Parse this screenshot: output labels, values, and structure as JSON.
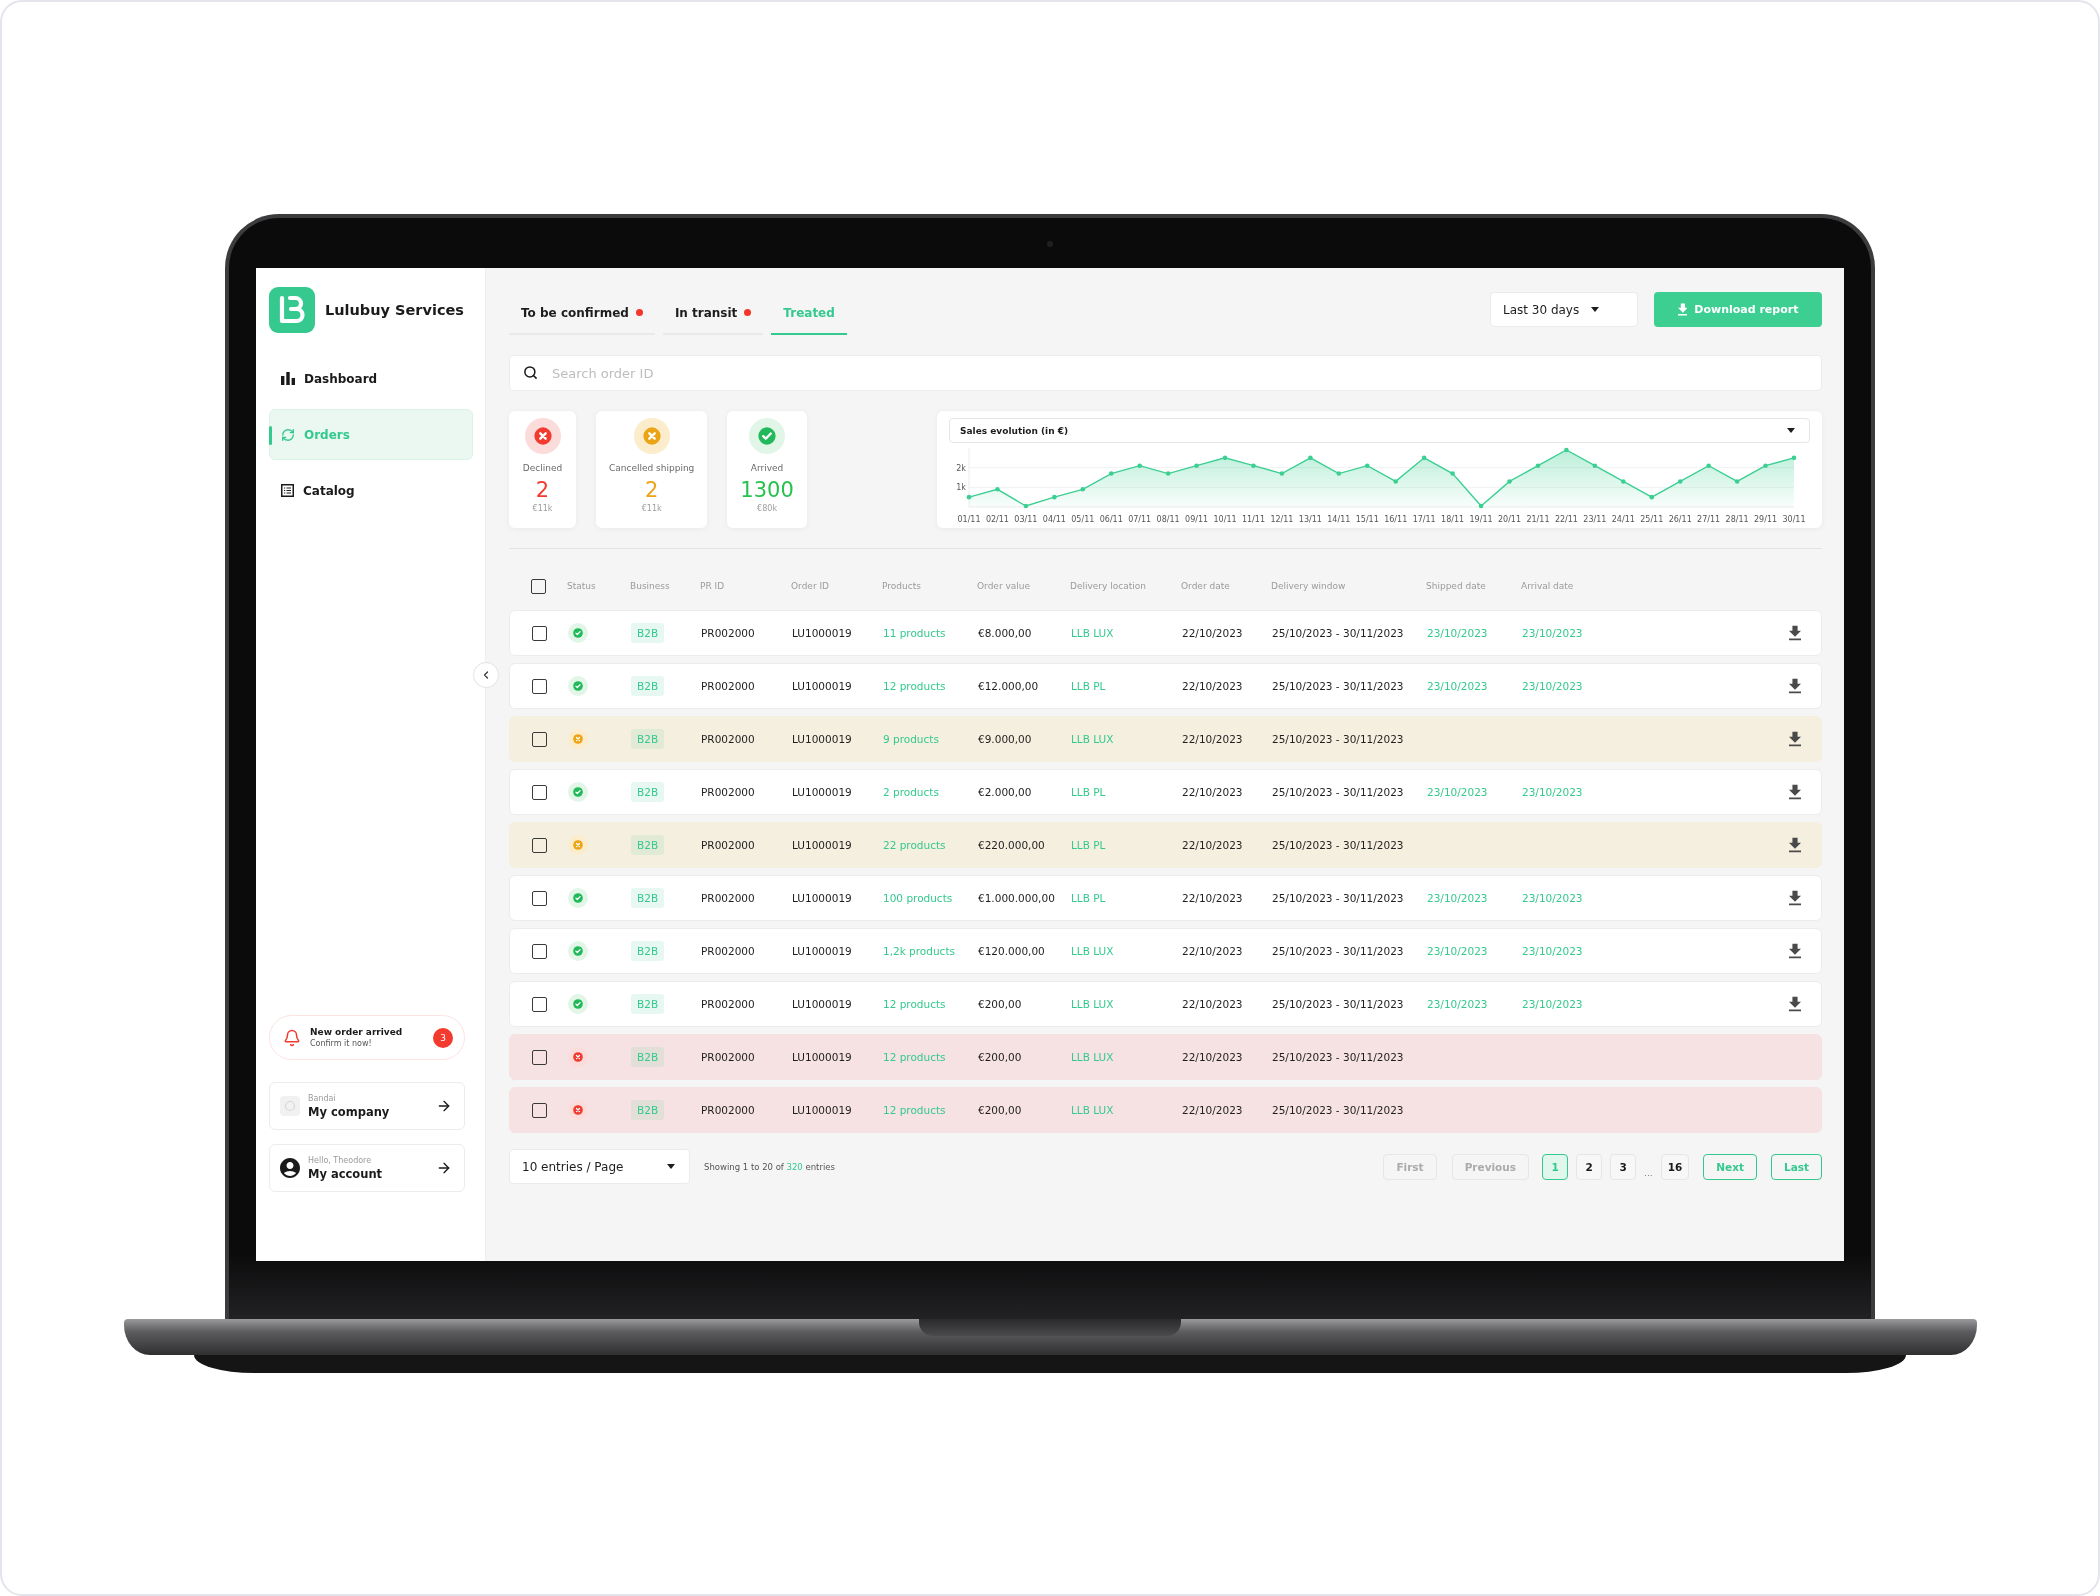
{
  "sidebar": {
    "brand": "Lulubuy Services",
    "nav": [
      {
        "label": "Dashboard",
        "selected": false
      },
      {
        "label": "Orders",
        "selected": true
      },
      {
        "label": "Catalog",
        "selected": false
      }
    ],
    "notification": {
      "title": "New order arrived",
      "subtitle": "Confirm it now!",
      "count": "3"
    },
    "company": {
      "caption": "Bandai",
      "label": "My company"
    },
    "account": {
      "caption": "Hello, Theodore",
      "label": "My account"
    }
  },
  "tabs": [
    {
      "label": "To be confirmed",
      "selected": false,
      "dot": true
    },
    {
      "label": "In transit",
      "selected": false,
      "dot": true
    },
    {
      "label": "Treated",
      "selected": true,
      "dot": false
    }
  ],
  "period": "Last 30 days",
  "download_button": "Download report",
  "search": {
    "placeholder": "Search order ID"
  },
  "summary_cards": [
    {
      "kind": "declined",
      "label": "Declined",
      "value": "2",
      "sub": "€11k"
    },
    {
      "kind": "cancelled",
      "label": "Cancelled shipping",
      "value": "2",
      "sub": "€11k"
    },
    {
      "kind": "arrived",
      "label": "Arrived",
      "value": "1300",
      "sub": "€80k"
    }
  ],
  "chart": {
    "selector": "Sales evolution (in €)",
    "chart_data": {
      "type": "area",
      "categories": [
        "01/11",
        "02/11",
        "03/11",
        "04/11",
        "05/11",
        "06/11",
        "07/11",
        "08/11",
        "09/11",
        "10/11",
        "11/11",
        "12/11",
        "13/11",
        "14/11",
        "15/11",
        "16/11",
        "17/11",
        "18/11",
        "19/11",
        "20/11",
        "21/11",
        "22/11",
        "23/11",
        "24/11",
        "25/11",
        "26/11",
        "27/11",
        "28/11",
        "29/11",
        "30/11"
      ],
      "series": [
        {
          "color": "#3ccf93",
          "values": [
            500,
            900,
            50,
            500,
            900,
            1700,
            2100,
            1700,
            2100,
            2500,
            2100,
            1700,
            2500,
            1700,
            2100,
            1300,
            2500,
            1700,
            50,
            1300,
            2100,
            2900,
            2100,
            1300,
            500,
            1300,
            2100,
            1300,
            2100,
            2500
          ]
        }
      ],
      "ylim": [
        0,
        3000
      ],
      "yticks": [
        {
          "value": 1000,
          "label": "1k"
        },
        {
          "value": 2000,
          "label": "2k"
        }
      ]
    }
  },
  "table": {
    "select_all_checked": false,
    "columns": [
      "Status",
      "Business",
      "PR ID",
      "Order ID",
      "Products",
      "Order value",
      "Delivery location",
      "Order date",
      "Delivery window",
      "Shipped date",
      "Arrival date"
    ],
    "rows": [
      {
        "checked": false,
        "kind": "arrived",
        "business": "B2B",
        "pr_id": "PR002000",
        "order_id": "LU1000019",
        "products": "11 products",
        "order_value": "€8.000,00",
        "delivery_location": "LLB LUX",
        "order_date": "22/10/2023",
        "delivery_window": "25/10/2023 - 30/11/2023",
        "shipped_date": "23/10/2023",
        "arrival_date": "23/10/2023",
        "downloadable": true
      },
      {
        "checked": false,
        "kind": "arrived",
        "business": "B2B",
        "pr_id": "PR002000",
        "order_id": "LU1000019",
        "products": "12 products",
        "order_value": "€12.000,00",
        "delivery_location": "LLB PL",
        "order_date": "22/10/2023",
        "delivery_window": "25/10/2023 - 30/11/2023",
        "shipped_date": "23/10/2023",
        "arrival_date": "23/10/2023",
        "downloadable": true
      },
      {
        "checked": false,
        "kind": "cancelled",
        "business": "B2B",
        "pr_id": "PR002000",
        "order_id": "LU1000019",
        "products": "9 products",
        "order_value": "€9.000,00",
        "delivery_location": "LLB LUX",
        "order_date": "22/10/2023",
        "delivery_window": "25/10/2023 - 30/11/2023",
        "downloadable": true
      },
      {
        "checked": false,
        "kind": "arrived",
        "business": "B2B",
        "pr_id": "PR002000",
        "order_id": "LU1000019",
        "products": "2 products",
        "order_value": "€2.000,00",
        "delivery_location": "LLB PL",
        "order_date": "22/10/2023",
        "delivery_window": "25/10/2023 - 30/11/2023",
        "shipped_date": "23/10/2023",
        "arrival_date": "23/10/2023",
        "downloadable": true
      },
      {
        "checked": false,
        "kind": "cancelled",
        "business": "B2B",
        "pr_id": "PR002000",
        "order_id": "LU1000019",
        "products": "22 products",
        "order_value": "€220.000,00",
        "delivery_location": "LLB PL",
        "order_date": "22/10/2023",
        "delivery_window": "25/10/2023 - 30/11/2023",
        "downloadable": true
      },
      {
        "checked": false,
        "kind": "arrived",
        "business": "B2B",
        "pr_id": "PR002000",
        "order_id": "LU1000019",
        "products": "100 products",
        "order_value": "€1.000.000,00",
        "delivery_location": "LLB PL",
        "order_date": "22/10/2023",
        "delivery_window": "25/10/2023 - 30/11/2023",
        "shipped_date": "23/10/2023",
        "arrival_date": "23/10/2023",
        "downloadable": true
      },
      {
        "checked": false,
        "kind": "arrived",
        "business": "B2B",
        "pr_id": "PR002000",
        "order_id": "LU1000019",
        "products": "1,2k products",
        "order_value": "€120.000,00",
        "delivery_location": "LLB LUX",
        "order_date": "22/10/2023",
        "delivery_window": "25/10/2023 - 30/11/2023",
        "shipped_date": "23/10/2023",
        "arrival_date": "23/10/2023",
        "downloadable": true
      },
      {
        "checked": false,
        "kind": "arrived",
        "business": "B2B",
        "pr_id": "PR002000",
        "order_id": "LU1000019",
        "products": "12 products",
        "order_value": "€200,00",
        "delivery_location": "LLB LUX",
        "order_date": "22/10/2023",
        "delivery_window": "25/10/2023 - 30/11/2023",
        "shipped_date": "23/10/2023",
        "arrival_date": "23/10/2023",
        "downloadable": true
      },
      {
        "checked": false,
        "kind": "declined",
        "business": "B2B",
        "pr_id": "PR002000",
        "order_id": "LU1000019",
        "products": "12 products",
        "order_value": "€200,00",
        "delivery_location": "LLB LUX",
        "order_date": "22/10/2023",
        "delivery_window": "25/10/2023 - 30/11/2023",
        "downloadable": false
      },
      {
        "checked": false,
        "kind": "declined",
        "business": "B2B",
        "pr_id": "PR002000",
        "order_id": "LU1000019",
        "products": "12 products",
        "order_value": "€200,00",
        "delivery_location": "LLB LUX",
        "order_date": "22/10/2023",
        "delivery_window": "25/10/2023 - 30/11/2023",
        "downloadable": false
      }
    ]
  },
  "page_size": "10 entries / Page",
  "showing": {
    "before": "Showing 1 to 20 of",
    "total": "320",
    "after": "entries"
  },
  "pagination": {
    "first": {
      "label": "First",
      "disabled": true
    },
    "previous": {
      "label": "Previous",
      "disabled": true
    },
    "pages": [
      {
        "kind": "page",
        "label": "1",
        "selected": true
      },
      {
        "kind": "page",
        "label": "2",
        "selected": false
      },
      {
        "kind": "page",
        "label": "3",
        "selected": false
      },
      {
        "kind": "gap",
        "label": "..."
      },
      {
        "kind": "page",
        "label": "16",
        "selected": false
      }
    ],
    "next": {
      "label": "Next",
      "disabled": false
    },
    "last": {
      "label": "Last",
      "disabled": false
    }
  }
}
